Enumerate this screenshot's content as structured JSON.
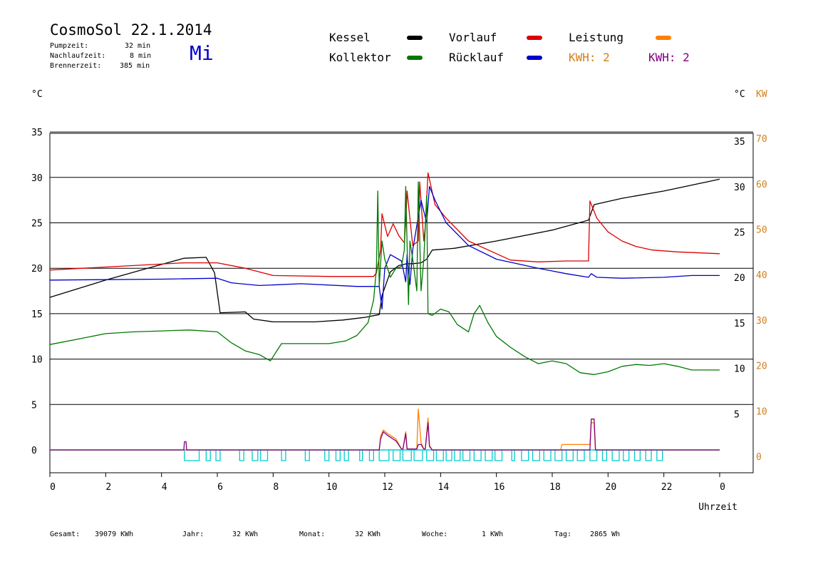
{
  "header": {
    "title": "CosmoSol 22.1.2014",
    "pumpzeit_label": "Pumpzeit:",
    "pumpzeit_value": "32 min",
    "nachlaufzeit_label": "Nachlaufzeit:",
    "nachlaufzeit_value": "8 min",
    "brennerzeit_label": "Brennerzeit:",
    "brennerzeit_value": "385 min",
    "weekday": "Mi"
  },
  "legend": {
    "kessel": "Kessel",
    "kollektor": "Kollektor",
    "vorlauf": "Vorlauf",
    "ruecklauf": "Rücklauf",
    "leistung": "Leistung",
    "kwh_orange": "KWH: 2",
    "kwh_purple": "KWH: 2"
  },
  "colors": {
    "kessel": "#000000",
    "kollektor": "#007800",
    "vorlauf": "#dd0000",
    "ruecklauf": "#0000cc",
    "leistung": "#ff8000",
    "kwh_purple": "#800080",
    "pump": "#00cccc",
    "orange_axis": "#d08020"
  },
  "footer": {
    "gesamt_label": "Gesamt:",
    "gesamt_value": "39079 KWh",
    "jahr_label": "Jahr:",
    "jahr_value": "32 KWh",
    "monat_label": "Monat:",
    "monat_value": "32 KWh",
    "woche_label": "Woche:",
    "woche_value": "1 KWh",
    "tag_label": "Tag:",
    "tag_value": "2865 Wh"
  },
  "chart_data": {
    "type": "line",
    "xlabel": "Uhrzeit",
    "y_left_unit": "°C",
    "y_right_unit": "°C",
    "y2_unit": "KW",
    "x_ticks": [
      "0",
      "2",
      "4",
      "6",
      "8",
      "10",
      "12",
      "14",
      "16",
      "18",
      "20",
      "22",
      "0"
    ],
    "xlim": [
      0,
      24
    ],
    "ylim": [
      -2.5,
      35
    ],
    "y_ticks_left": [
      0,
      5,
      10,
      15,
      20,
      25,
      30,
      35
    ],
    "y_ticks_right": [
      5,
      10,
      15,
      20,
      25,
      30,
      35
    ],
    "y2_ticks": [
      0,
      10,
      20,
      30,
      40,
      50,
      60,
      70
    ],
    "grid": "horizontal",
    "series": [
      {
        "name": "Kessel",
        "x": [
          0,
          2,
          3.5,
          4.8,
          5.6,
          5.9,
          6.1,
          7,
          7.3,
          8,
          9.5,
          10.5,
          11.3,
          11.8,
          11.9,
          12.2,
          12.5,
          12.8,
          13.0,
          13.3,
          13.5,
          13.7,
          14.5,
          16,
          18,
          19.3,
          19.5,
          20.5,
          22,
          24
        ],
        "y": [
          16.8,
          18.7,
          20.0,
          21.1,
          21.2,
          19.5,
          15.1,
          15.2,
          14.4,
          14.1,
          14.1,
          14.3,
          14.6,
          14.9,
          17.0,
          19.6,
          20.3,
          20.5,
          20.5,
          20.6,
          21.0,
          22.0,
          22.2,
          23.0,
          24.2,
          25.3,
          27.0,
          27.7,
          28.5,
          29.8
        ]
      },
      {
        "name": "Vorlauf",
        "x": [
          0,
          4.8,
          6.0,
          7.0,
          8.0,
          10.0,
          11.6,
          11.7,
          11.85,
          11.9,
          12.1,
          12.3,
          12.5,
          12.7,
          12.75,
          12.8,
          13.0,
          13.2,
          13.25,
          13.4,
          13.45,
          13.55,
          13.8,
          14.2,
          15,
          16,
          16.5,
          17.5,
          18.5,
          19.3,
          19.35,
          19.6,
          20.0,
          20.5,
          21.0,
          21.6,
          22.5,
          24
        ],
        "y": [
          19.8,
          20.6,
          20.6,
          20.0,
          19.2,
          19.1,
          19.1,
          19.5,
          22.0,
          26.0,
          23.5,
          24.9,
          23.6,
          22.8,
          25.0,
          28.5,
          22.5,
          23.0,
          29.5,
          23.0,
          24.5,
          30.5,
          27.0,
          25.5,
          23.0,
          21.6,
          20.9,
          20.7,
          20.8,
          20.8,
          27.4,
          25.5,
          24.0,
          23.0,
          22.4,
          22.0,
          21.8,
          21.6
        ]
      },
      {
        "name": "Rücklauf",
        "x": [
          0,
          4.0,
          6.0,
          6.5,
          7.5,
          9.0,
          11.0,
          11.8,
          11.9,
          12.0,
          12.2,
          12.6,
          12.75,
          12.8,
          12.9,
          13.0,
          13.3,
          13.5,
          13.6,
          13.8,
          14.2,
          15,
          16,
          17.5,
          18.5,
          19.3,
          19.4,
          19.6,
          20.5,
          22,
          23,
          24
        ],
        "y": [
          18.7,
          18.8,
          18.9,
          18.4,
          18.1,
          18.3,
          18.0,
          18.0,
          15.5,
          20.0,
          21.5,
          20.8,
          18.5,
          21.5,
          18.2,
          22.0,
          27.5,
          25.0,
          29.0,
          27.5,
          25.0,
          22.5,
          21.0,
          20.0,
          19.4,
          19.0,
          19.4,
          19.0,
          18.9,
          19.0,
          19.2,
          19.2
        ]
      },
      {
        "name": "Kollektor",
        "x": [
          0,
          1,
          2,
          3,
          4,
          5,
          6,
          6.5,
          7,
          7.5,
          7.9,
          8.3,
          9,
          10,
          10.6,
          11.0,
          11.4,
          11.6,
          11.7,
          11.75,
          11.8,
          11.9,
          12.0,
          12.2,
          12.4,
          12.6,
          12.7,
          12.75,
          12.85,
          12.9,
          13.0,
          13.15,
          13.2,
          13.3,
          13.4,
          13.5,
          13.55,
          13.7,
          14.0,
          14.3,
          14.6,
          15.0,
          15.2,
          15.4,
          15.7,
          16,
          16.5,
          17,
          17.5,
          18,
          18.5,
          19,
          19.5,
          20,
          20.5,
          21,
          21.5,
          22,
          22.5,
          23,
          24
        ],
        "y": [
          11.6,
          12.2,
          12.8,
          13.0,
          13.1,
          13.2,
          13.0,
          11.8,
          10.9,
          10.5,
          9.8,
          11.7,
          11.7,
          11.7,
          12.0,
          12.6,
          14.0,
          16.5,
          20.0,
          28.5,
          18.0,
          23.0,
          21.0,
          19.0,
          20.0,
          20.2,
          22.0,
          29.0,
          16.0,
          23.0,
          21.0,
          17.5,
          29.5,
          17.5,
          21.0,
          28.0,
          15.0,
          14.8,
          15.5,
          15.2,
          13.8,
          13.0,
          15.0,
          15.9,
          14.0,
          12.5,
          11.3,
          10.3,
          9.5,
          9.8,
          9.5,
          8.5,
          8.3,
          8.6,
          9.2,
          9.4,
          9.3,
          9.5,
          9.2,
          8.8,
          8.8
        ]
      },
      {
        "name": "Leistung",
        "x": [
          0,
          11.8,
          11.85,
          11.95,
          12.1,
          12.4,
          12.6,
          12.65,
          12.75,
          12.8,
          13.0,
          13.15,
          13.2,
          13.3,
          13.4,
          13.45,
          13.55,
          13.6,
          13.7,
          18.3,
          18.35,
          19.35,
          19.4,
          19.5,
          19.55,
          24
        ],
        "y": [
          0,
          0,
          1.5,
          2.2,
          1.8,
          1.2,
          0.1,
          0.1,
          2.0,
          0.1,
          0.1,
          0.1,
          4.5,
          0.8,
          0.1,
          0.1,
          3.5,
          0.5,
          0,
          0,
          0.6,
          0.6,
          3.0,
          3.0,
          0,
          0
        ]
      },
      {
        "name": "KWH",
        "x": [
          0,
          4.8,
          4.82,
          4.88,
          4.9,
          11.8,
          11.85,
          11.95,
          12.1,
          12.4,
          12.6,
          12.65,
          12.75,
          12.8,
          13.0,
          13.15,
          13.2,
          13.3,
          13.4,
          13.45,
          13.55,
          13.6,
          13.7,
          19.35,
          19.4,
          19.5,
          19.55,
          24
        ],
        "y": [
          0,
          0,
          0.9,
          0.9,
          0,
          0,
          1.2,
          2.0,
          1.6,
          1.0,
          0.1,
          0.1,
          1.8,
          0.1,
          0.1,
          0.1,
          0.6,
          0.6,
          0.1,
          0.1,
          3.0,
          0.4,
          0,
          0,
          3.4,
          3.4,
          0,
          0
        ]
      }
    ],
    "pump_segments": [
      [
        4.82,
        5.35
      ],
      [
        5.6,
        5.75
      ],
      [
        5.95,
        6.1
      ],
      [
        6.8,
        6.95
      ],
      [
        7.25,
        7.45
      ],
      [
        7.55,
        7.8
      ],
      [
        8.3,
        8.45
      ],
      [
        9.15,
        9.3
      ],
      [
        9.85,
        10.0
      ],
      [
        10.25,
        10.4
      ],
      [
        10.55,
        10.7
      ],
      [
        11.1,
        11.2
      ],
      [
        11.45,
        11.6
      ],
      [
        11.8,
        12.15
      ],
      [
        12.3,
        12.55
      ],
      [
        12.65,
        12.95
      ],
      [
        13.05,
        13.35
      ],
      [
        13.5,
        13.75
      ],
      [
        13.85,
        14.1
      ],
      [
        14.2,
        14.4
      ],
      [
        14.5,
        14.7
      ],
      [
        14.8,
        15.05
      ],
      [
        15.2,
        15.45
      ],
      [
        15.6,
        15.85
      ],
      [
        15.95,
        16.2
      ],
      [
        16.55,
        16.65
      ],
      [
        16.9,
        17.15
      ],
      [
        17.3,
        17.55
      ],
      [
        17.7,
        17.95
      ],
      [
        18.1,
        18.35
      ],
      [
        18.5,
        18.75
      ],
      [
        18.9,
        19.15
      ],
      [
        19.35,
        19.6
      ],
      [
        19.8,
        19.95
      ],
      [
        20.15,
        20.4
      ],
      [
        20.55,
        20.75
      ],
      [
        20.95,
        21.15
      ],
      [
        21.35,
        21.55
      ],
      [
        21.75,
        21.95
      ]
    ]
  }
}
